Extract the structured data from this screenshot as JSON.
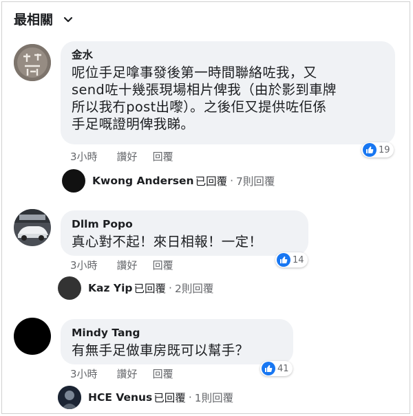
{
  "sort": {
    "label": "最相關",
    "icon": "chevron-down-icon"
  },
  "comments": [
    {
      "author": "金水",
      "avatar": "stamp-avatar",
      "lines": [
        "呢位手足嗱事發後第一時間聯絡咗我，又",
        "send咗十幾張現場相片俾我（由於影到車牌",
        "所以我冇post出嚟）。之後佢又提供咗佢係",
        "手足嘅證明俾我睇。"
      ],
      "time": "3小時",
      "like_label": "讚好",
      "reply_label": "回覆",
      "reactions": "19",
      "reply": {
        "name": "Kwong Andersen",
        "text": "已回覆",
        "dot": "·",
        "count": "7則回覆"
      }
    },
    {
      "author": "Dllm Popo",
      "avatar": "car-photo-avatar",
      "lines": [
        "真心對不起！來日相報！一定！"
      ],
      "time": "3小時",
      "like_label": "讚好",
      "reply_label": "回覆",
      "reactions": "14",
      "reply": {
        "name": "Kaz Yip",
        "text": "已回覆",
        "dot": "·",
        "count": "2則回覆"
      }
    },
    {
      "author": "Mindy Tang",
      "avatar": "black-avatar",
      "lines": [
        "有無手足做車房既可以幫手？"
      ],
      "time": "3小時",
      "like_label": "讚好",
      "reply_label": "回覆",
      "reactions": "41",
      "reply": {
        "name": "HCE Venus",
        "text": "已回覆",
        "dot": "·",
        "count": "1則回覆"
      }
    }
  ],
  "colors": {
    "bubble": "#f0f2f5",
    "like_blue": "#1877f2",
    "meta_gray": "#65676b"
  }
}
